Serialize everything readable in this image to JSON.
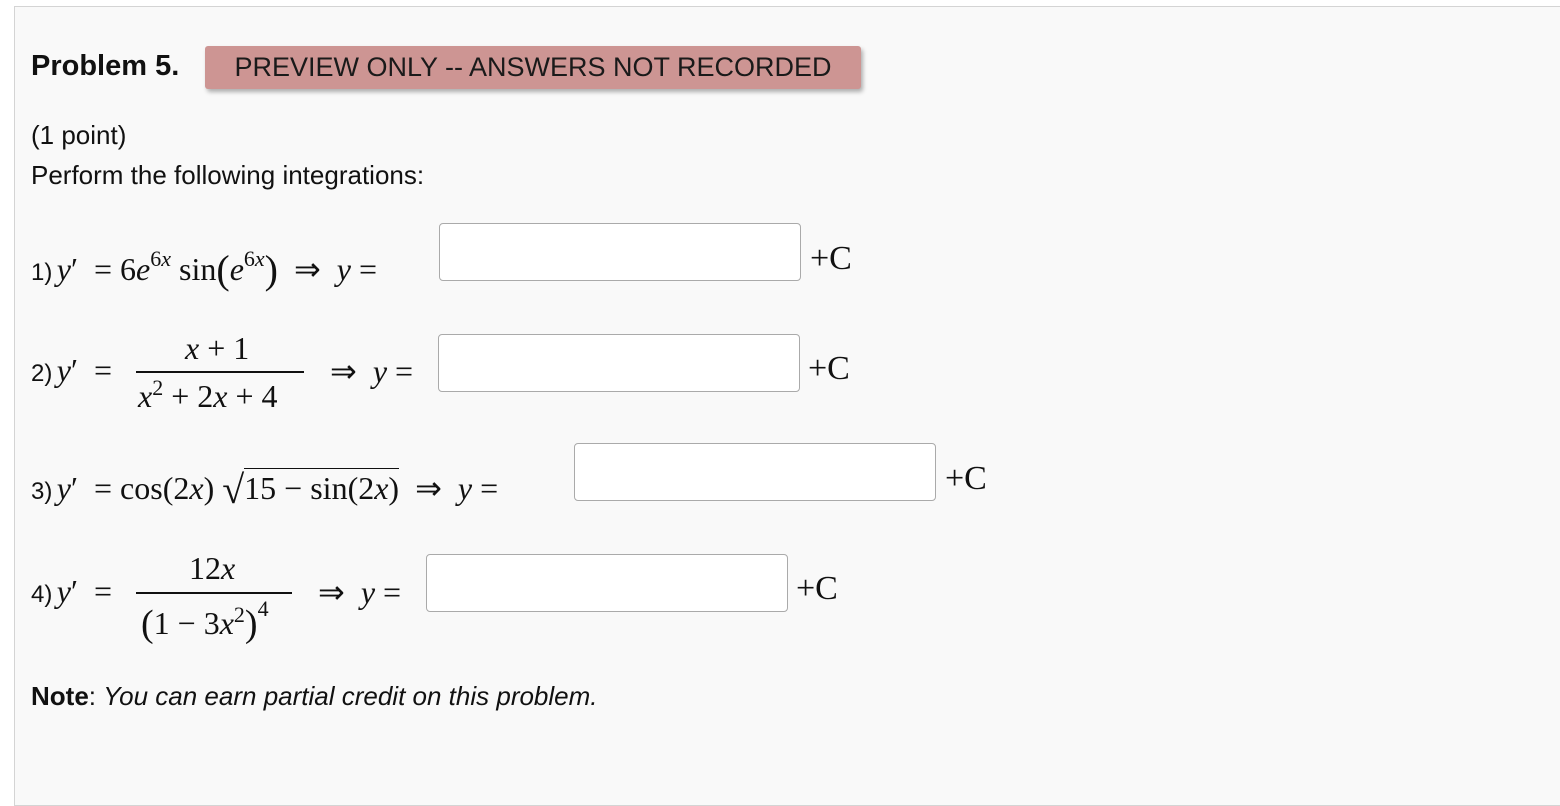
{
  "problem": {
    "title": "Problem 5.",
    "banner": "PREVIEW ONLY -- ANSWERS NOT RECORDED",
    "points": "(1 point)",
    "instructions": "Perform the following integrations:"
  },
  "items": [
    {
      "number": "1)",
      "answer_value": "",
      "suffix": "+C"
    },
    {
      "number": "2)",
      "answer_value": "",
      "suffix": "+C",
      "numerator": "x + 1"
    },
    {
      "number": "3)",
      "answer_value": "",
      "suffix": "+C"
    },
    {
      "number": "4)",
      "answer_value": "",
      "suffix": "+C",
      "numerator": "12x"
    }
  ],
  "note": {
    "label": "Note",
    "text": "You can earn partial credit on this problem."
  }
}
